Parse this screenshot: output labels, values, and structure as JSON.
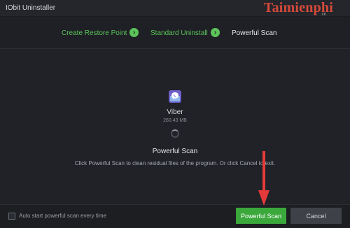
{
  "window": {
    "title": "IObit Uninstaller",
    "watermark": "Taimienphi",
    "watermark_sub": ".vn"
  },
  "steps": [
    {
      "label": "Create Restore Point",
      "state": "done"
    },
    {
      "label": "Standard Uninstall",
      "state": "done"
    },
    {
      "label": "Powerful Scan",
      "state": "current"
    }
  ],
  "app": {
    "name": "Viber",
    "size": "260.43 MB",
    "icon": "viber-icon"
  },
  "scan": {
    "title": "Powerful Scan",
    "description": "Click Powerful Scan to clean residual files of the program. Or click Cancel to exit."
  },
  "footer": {
    "auto_scan_label": "Auto start powerful scan every time",
    "auto_scan_checked": false,
    "powerful_scan_button": "Powerful Scan",
    "cancel_button": "Cancel"
  },
  "colors": {
    "accent_green": "#3ba83c",
    "step_done": "#5cc45a",
    "annotation_arrow": "#e53a3a",
    "background": "#202227"
  }
}
